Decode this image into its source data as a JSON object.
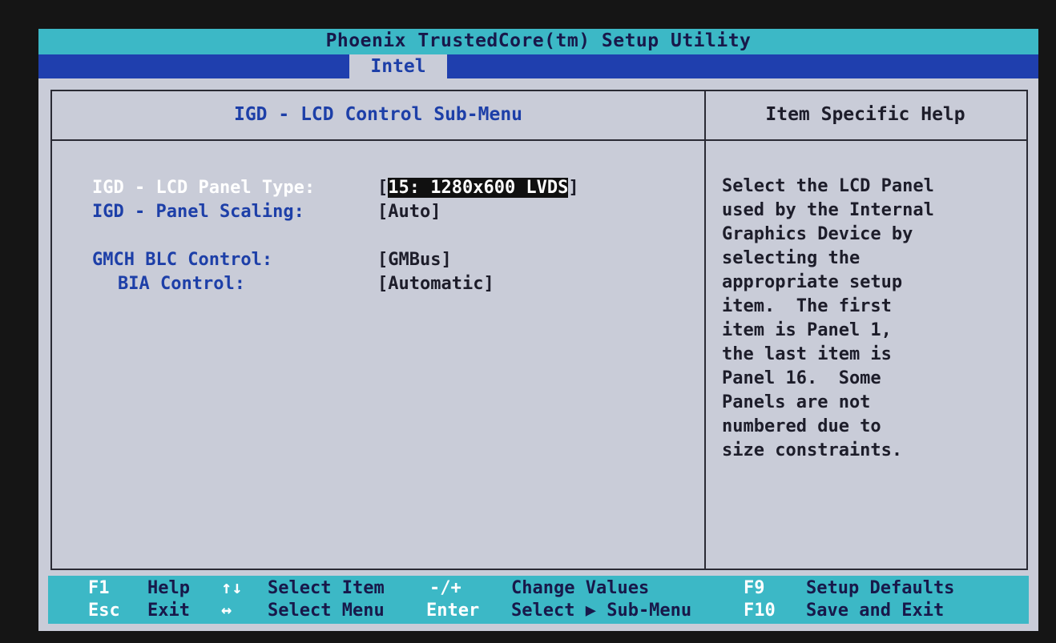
{
  "title": "Phoenix TrustedCore(tm) Setup Utility",
  "active_tab": "Intel",
  "submenu_title": "IGD - LCD Control Sub-Menu",
  "help_title": "Item Specific Help",
  "settings": [
    {
      "label": "IGD - LCD Panel Type:",
      "value_open": "[",
      "value": "15: 1280x600 LVDS",
      "value_close": "]"
    },
    {
      "label": "IGD - Panel Scaling:",
      "value": "[Auto]"
    },
    {
      "label": "GMCH BLC Control:",
      "value": "[GMBus]"
    },
    {
      "label": "BIA Control:",
      "value": "[Automatic]"
    }
  ],
  "help_lines": [
    "Select the LCD Panel",
    "used by the Internal",
    "Graphics Device by",
    "selecting the",
    "appropriate setup",
    "item.  The first",
    "item is Panel 1,",
    "the last item is",
    "Panel 16.  Some",
    "Panels are not",
    "numbered due to",
    "size constraints."
  ],
  "footer": {
    "f1_key": "F1",
    "f1_desc": "Help",
    "arrows_ud": "↑↓",
    "select_item": "Select Item",
    "minus_plus": "-/+",
    "change_values": "Change Values",
    "f9_key": "F9",
    "setup_defaults": "Setup Defaults",
    "esc_key": "Esc",
    "esc_desc": "Exit",
    "arrows_lr": "↔",
    "select_menu": "Select Menu",
    "enter_key": "Enter",
    "select_submenu": "Select ▶ Sub-Menu",
    "f10_key": "F10",
    "save_exit": "Save and Exit"
  },
  "colors": {
    "screen_bg": "#c9ccd8",
    "title_bar": "#3cb8c6",
    "tab_bar": "#1f3fae",
    "label_blue": "#1d3fa8",
    "highlight": "#101010"
  }
}
